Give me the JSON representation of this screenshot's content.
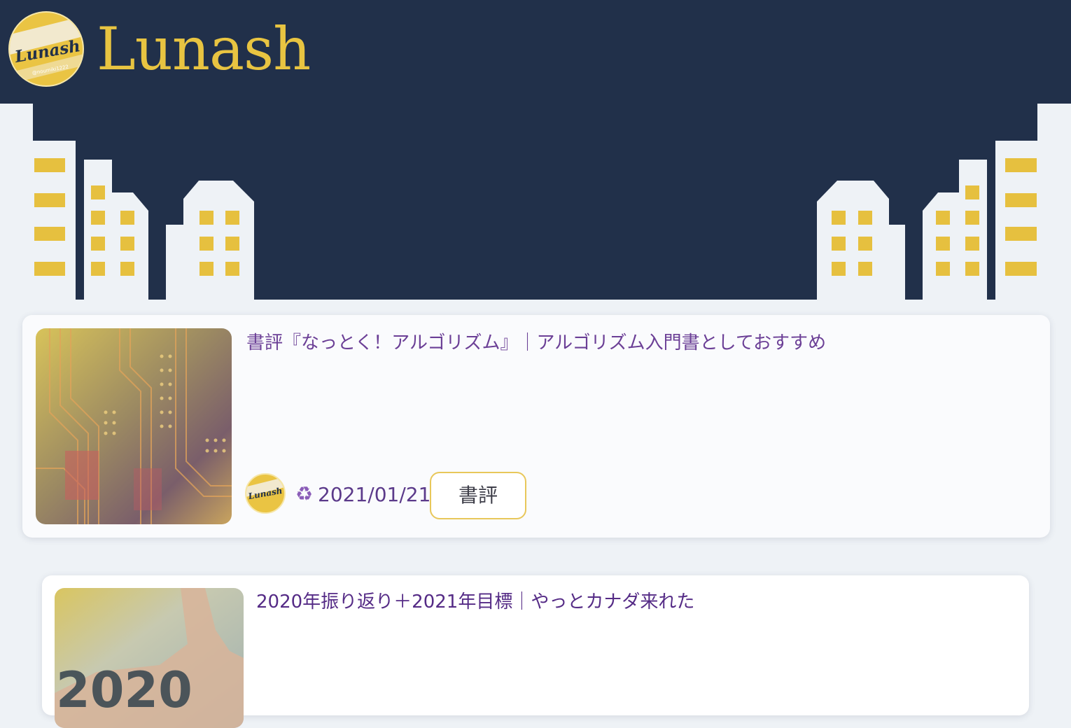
{
  "site": {
    "title": "Lunash",
    "logo_text": "Lunash",
    "logo_subtext": "@noumiki1222"
  },
  "colors": {
    "header_bg": "#21304a",
    "accent_yellow": "#e8c441",
    "page_bg": "#eef2f6",
    "title_purple": "#6b3f96"
  },
  "posts": [
    {
      "title": "書評『なっとく！アルゴリズム』｜アルゴリズム入門書としておすすめ",
      "update_icon": "♻",
      "date": "2021/01/21",
      "category": "書評",
      "thumbnail": "circuit-board-image"
    },
    {
      "title": "2020年振り返り＋2021年目標｜やっとカナダ来れた",
      "thumbnail": "hand-holding-2020-numbers-image"
    }
  ]
}
